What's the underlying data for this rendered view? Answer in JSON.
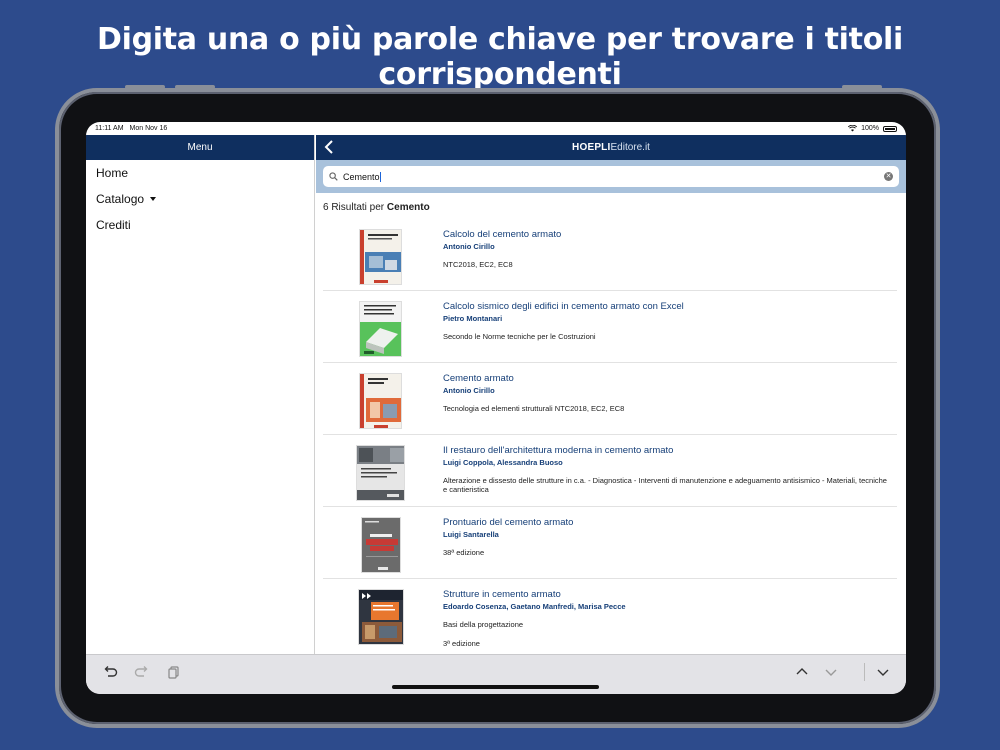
{
  "headline": "Digita una o più parole chiave per trovare i titoli corrispondenti",
  "status_bar": {
    "time": "11:11 AM",
    "date": "Mon Nov 16",
    "battery": "100%"
  },
  "sidebar": {
    "header": "Menu",
    "items": [
      {
        "label": "Home"
      },
      {
        "label": "Catalogo",
        "has_dropdown": true
      },
      {
        "label": "Crediti"
      }
    ]
  },
  "navbar": {
    "brand_bold": "HOEPLI",
    "brand_light": "Editore.it",
    "back_icon": "chevron-left-icon"
  },
  "search": {
    "value": "Cemento",
    "icon": "search-icon",
    "clear_icon": "clear-icon"
  },
  "results_header": {
    "prefix": "6 Risultati per ",
    "term": "Cemento"
  },
  "results": [
    {
      "title": "Calcolo del cemento armato",
      "author": "Antonio Cirillo",
      "description": "NTC2018, EC2, EC8",
      "extra": "",
      "cover_color": "#4a7fb5"
    },
    {
      "title": "Calcolo sismico degli edifici in cemento armato con Excel",
      "author": "Pietro Montanari",
      "description": "Secondo le Norme tecniche per le Costruzioni",
      "extra": "",
      "cover_color": "#58c25b"
    },
    {
      "title": "Cemento armato",
      "author": "Antonio Cirillo",
      "description": "Tecnologia ed elementi strutturali NTC2018, EC2, EC8",
      "extra": "",
      "cover_color": "#e06a3a"
    },
    {
      "title": "Il restauro dell'architettura moderna in cemento armato",
      "author": "Luigi Coppola, Alessandra Buoso",
      "description": "Alterazione e dissesto delle strutture in c.a. - Diagnostica - Interventi di manutenzione e adeguamento antisismico - Materiali, tecniche e cantieristica",
      "extra": "",
      "cover_color": "#7a7f85"
    },
    {
      "title": "Prontuario del cemento armato",
      "author": "Luigi Santarella",
      "description": "38ª edizione",
      "extra": "",
      "cover_color": "#6b6b6b"
    },
    {
      "title": "Strutture in cemento armato",
      "author": "Edoardo Cosenza, Gaetano Manfredi, Marisa Pecce",
      "description": "Basi della progettazione",
      "extra": "3ª edizione",
      "cover_color": "#e8772e"
    }
  ],
  "toolbar": {
    "left": [
      "undo-icon",
      "redo-icon",
      "copy-icon"
    ],
    "right": [
      "chevron-up-icon",
      "chevron-down-icon",
      "chevron-down-icon"
    ]
  }
}
